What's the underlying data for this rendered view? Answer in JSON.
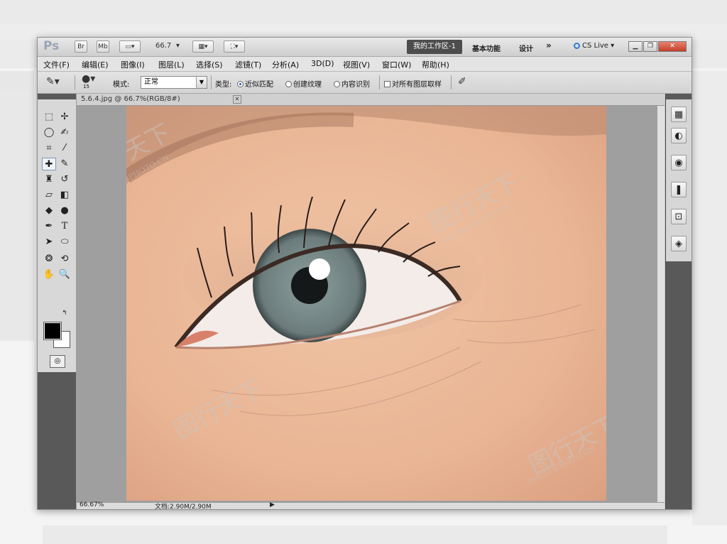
{
  "app": {
    "logo": "Ps",
    "zoom_dropdown": "66.7",
    "workspace_button": "我的工作区-1",
    "workspace_items": [
      "基本功能",
      "设计"
    ],
    "overflow": "»",
    "cs_live": "CS Live"
  },
  "menu": [
    "文件(F)",
    "编辑(E)",
    "图像(I)",
    "图层(L)",
    "选择(S)",
    "滤镜(T)",
    "分析(A)",
    "3D(D)",
    "视图(V)",
    "窗口(W)",
    "帮助(H)"
  ],
  "options": {
    "brush_size": "15",
    "mode_label": "模式:",
    "mode_value": "正常",
    "type_label": "类型:",
    "radio_1": "近似匹配",
    "radio_2": "创建纹理",
    "radio_3": "内容识别",
    "checkbox": "对所有图层取样"
  },
  "document": {
    "tab_title": "5.6.4.jpg @ 66.7%(RGB/8#)",
    "zoom_status": "66.67%",
    "doc_size": "文档:2.90M/2.90M"
  },
  "watermark_text": "图行天下",
  "watermark_url": "PHOTOPHOTO.CN"
}
